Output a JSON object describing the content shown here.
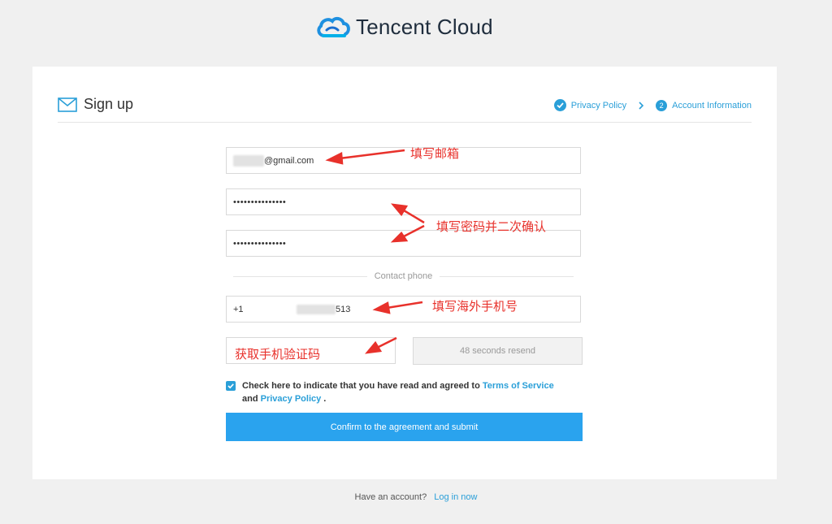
{
  "brand": {
    "name": "Tencent Cloud"
  },
  "header": {
    "title": "Sign up",
    "steps": [
      {
        "label": "Privacy Policy",
        "state": "done"
      },
      {
        "number": "2",
        "label": "Account Information",
        "state": "current"
      }
    ]
  },
  "form": {
    "email_suffix": "@gmail.com",
    "password_mask": "•••••••••••••••",
    "confirm_password_mask": "•••••••••••••••",
    "contact_divider": "Contact phone",
    "phone_prefix": "+1",
    "phone_suffix": "513",
    "verify_button": "48 seconds resend",
    "agreement": {
      "text_before": "Check here to indicate that you have read and agreed to ",
      "terms_link": "Terms of Service",
      "and_text": " and ",
      "privacy_link": "Privacy Policy",
      "end_text": " ."
    },
    "submit_label": "Confirm to the agreement and submit"
  },
  "footer": {
    "have_account": "Have an account?",
    "login_link": "Log in now"
  },
  "annotations": {
    "email": "填写邮箱",
    "password": "填写密码并二次确认",
    "phone": "填写海外手机号",
    "code": "获取手机验证码"
  },
  "colors": {
    "accent": "#2a9fd8",
    "submit": "#2aa3ee",
    "annotation": "#e8312b"
  }
}
